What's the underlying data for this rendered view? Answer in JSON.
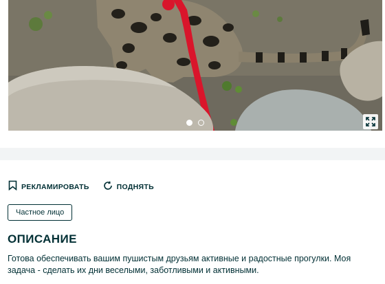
{
  "gallery": {
    "photo_alt": "",
    "photo_count": 2,
    "active_index": 0,
    "expand_icon": "expand-icon"
  },
  "actions": {
    "promote_label": "РЕКЛАМИРОВАТЬ",
    "promote_icon": "bookmark-icon",
    "raise_label": "ПОДНЯТЬ",
    "raise_icon": "refresh-icon"
  },
  "seller": {
    "type_label": "Частное лицо"
  },
  "description": {
    "title": "ОПИСАНИЕ",
    "text": "Готова обеспечивать вашим пушистым друзьям активные и радостные прогулки. Моя задача - сделать их дни веселыми, заботливыми и активными."
  },
  "colors": {
    "text": "#002f34",
    "band": "#f2f4f5",
    "leash": "#d9152b"
  }
}
